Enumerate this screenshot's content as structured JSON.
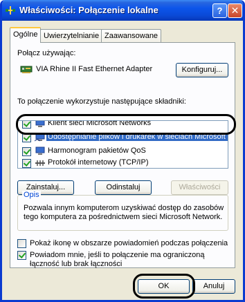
{
  "window": {
    "title": "Właściwości: Połączenie lokalne",
    "help_glyph": "?",
    "close_glyph": "✕"
  },
  "tabs": [
    {
      "label": "Ogólne",
      "active": true
    },
    {
      "label": "Uwierzytelnianie",
      "active": false
    },
    {
      "label": "Zaawansowane",
      "active": false
    }
  ],
  "general": {
    "connect_using_label": "Połącz używając:",
    "adapter_name": "VIA Rhine II Fast Ethernet Adapter",
    "configure_button": "Konfiguruj...",
    "components_label": "To połączenie wykorzystuje następujące składniki:",
    "components": [
      {
        "label": "Klient sieci Microsoft Networks",
        "checked": true,
        "icon": "network-client-icon"
      },
      {
        "label": "Udostępnianie plików i drukarek w sieciach Microsoft N...",
        "checked": true,
        "icon": "file-printer-sharing-icon",
        "selected": true
      },
      {
        "label": "Harmonogram pakietów QoS",
        "checked": true,
        "icon": "qos-scheduler-icon"
      },
      {
        "label": "Protokół internetowy (TCP/IP)",
        "checked": true,
        "icon": "protocol-icon"
      }
    ],
    "install_button": "Zainstaluj...",
    "uninstall_button": "Odinstaluj",
    "properties_button": "Właściwości",
    "description_legend": "Opis",
    "description_text": "Pozwala innym komputerom uzyskiwać dostęp do zasobów tego komputera za pośrednictwem sieci Microsoft Network.",
    "show_icon_label": "Pokaż ikonę w obszarze powiadomień podczas połączenia",
    "show_icon_checked": false,
    "notify_label": "Powiadom mnie, jeśli to połączenie ma ograniczoną łączność lub brak łączności",
    "notify_checked": true
  },
  "footer": {
    "ok_button": "OK",
    "cancel_button": "Anuluj"
  },
  "colors": {
    "titlebar": "#0a49d6",
    "selection": "#316ac5",
    "dialog_bg": "#ece9d8"
  }
}
